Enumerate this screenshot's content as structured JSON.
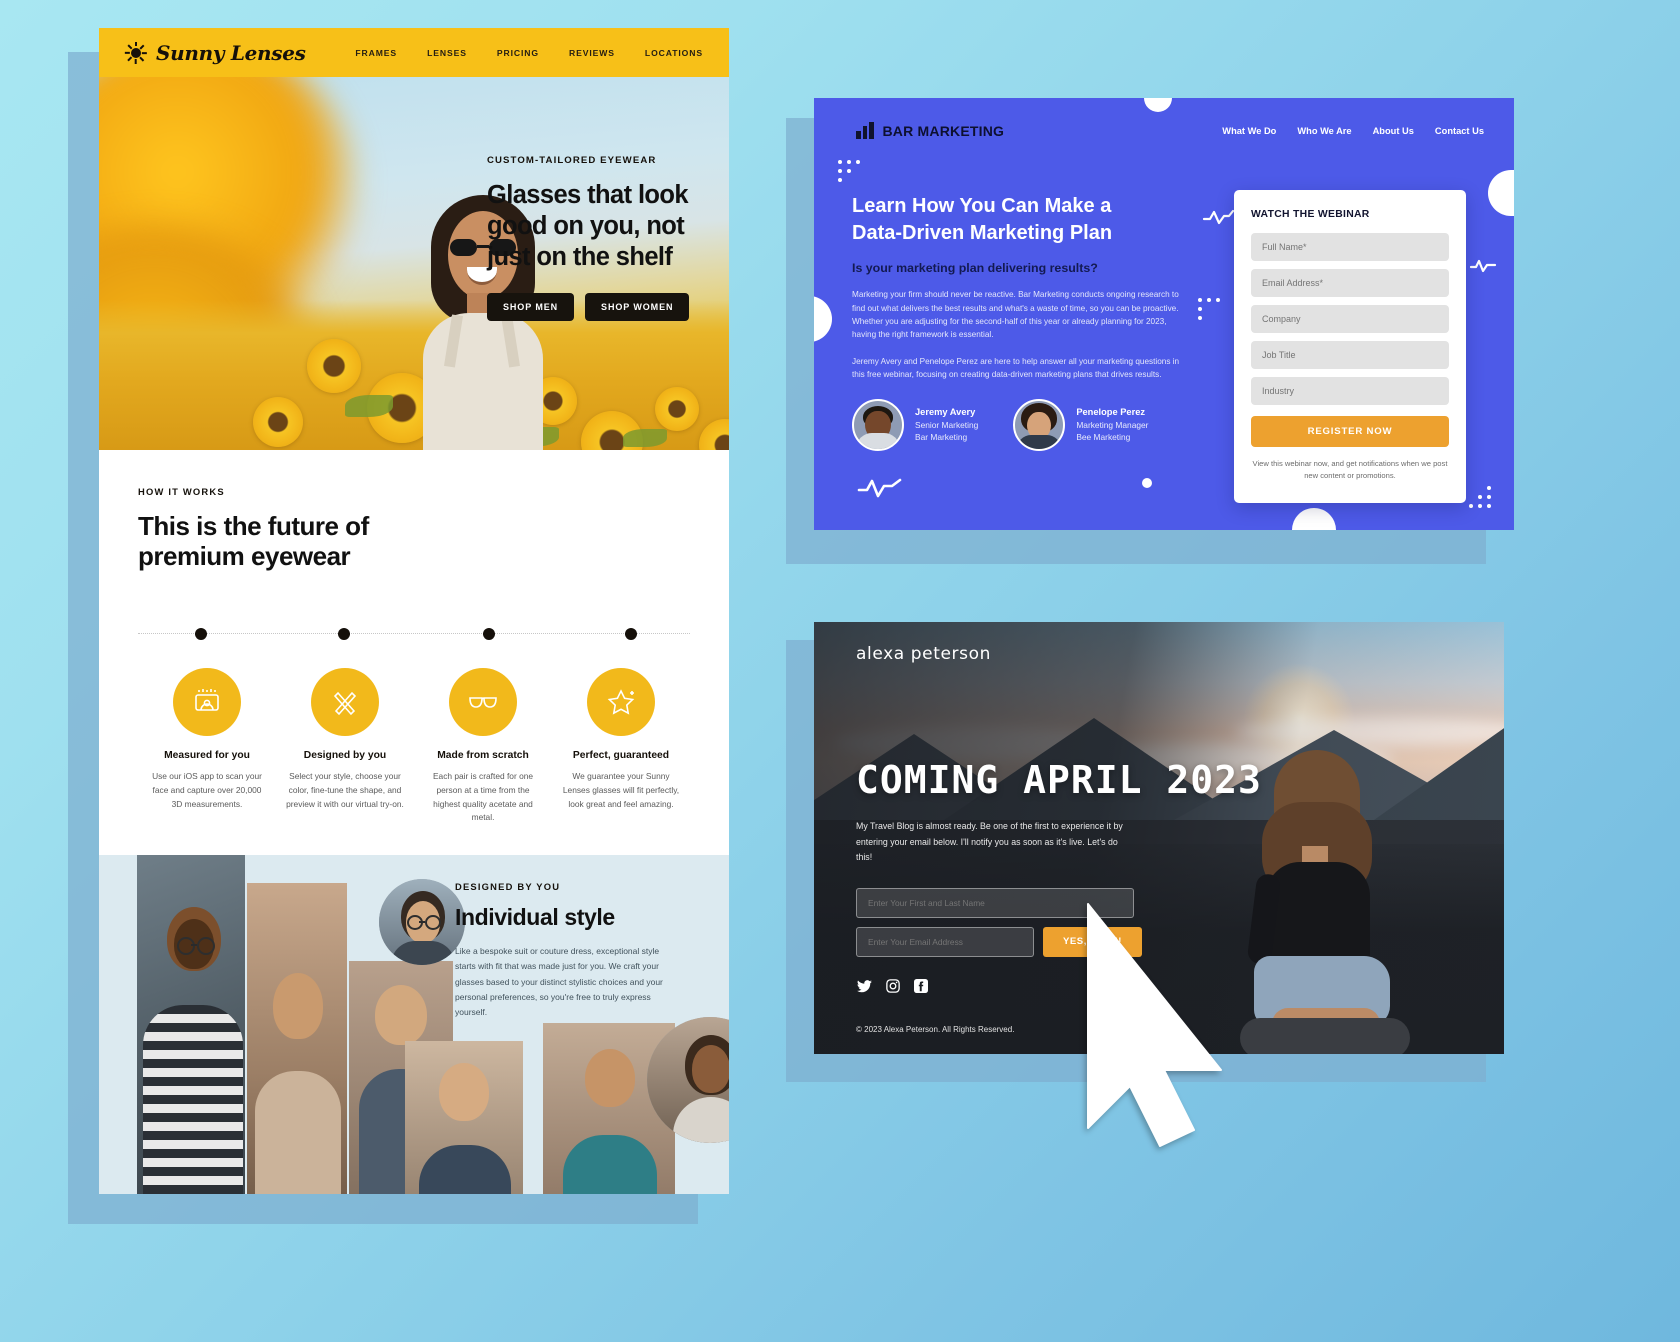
{
  "canvas": {
    "accent_yellow": "#f2b91b",
    "accent_blue": "#4d5ae8",
    "accent_orange": "#eda12f"
  },
  "sunny": {
    "brand": "Sunny Lenses",
    "logo_icon": "sun-icon",
    "nav": [
      "FRAMES",
      "LENSES",
      "PRICING",
      "REVIEWS",
      "LOCATIONS"
    ],
    "hero": {
      "eyebrow": "CUSTOM-TAILORED EYEWEAR",
      "heading_lines": [
        "Glasses that look",
        "good on you, not",
        "just on the shelf"
      ],
      "buttons": [
        "SHOP MEN",
        "SHOP WOMEN"
      ]
    },
    "how": {
      "label": "HOW IT WORKS",
      "heading_lines": [
        "This is the future of",
        "premium eyewear"
      ],
      "cards": [
        {
          "icon": "face-scan-icon",
          "title": "Measured for you",
          "text": "Use our iOS app to scan your face and capture over 20,000 3D measurements."
        },
        {
          "icon": "pencil-ruler-icon",
          "title": "Designed by you",
          "text": "Select your style, choose your color, fine-tune the shape, and preview it with our virtual try-on."
        },
        {
          "icon": "glasses-icon",
          "title": "Made from scratch",
          "text": "Each pair is crafted for one person at a time from the highest quality acetate and metal."
        },
        {
          "icon": "star-badge-icon",
          "title": "Perfect, guaranteed",
          "text": "We guarantee your Sunny Lenses glasses will fit perfectly, look great and feel amazing."
        }
      ]
    },
    "individual": {
      "label": "DESIGNED BY YOU",
      "heading": "Individual style",
      "text": "Like a bespoke suit or couture dress, exceptional style starts with fit that was made just for you. We craft your glasses based to your distinct stylistic choices and your personal preferences, so you're free to truly express yourself."
    }
  },
  "bar": {
    "brand": "BAR MARKETING",
    "logo_icon": "bar-chart-icon",
    "nav": [
      "What We Do",
      "Who We Are",
      "About Us",
      "Contact Us"
    ],
    "heading_lines": [
      "Learn How You Can Make a",
      "Data-Driven Marketing Plan"
    ],
    "subheading": "Is your marketing plan delivering results?",
    "paragraph1": "Marketing your firm should never be reactive. Bar Marketing conducts ongoing research to find out what delivers the best results and what's a waste of time, so you can be proactive. Whether you are adjusting for the second-half of this year or already planning for 2023, having the right framework is essential.",
    "paragraph2": "Jeremy Avery and Penelope Perez are here to help answer all your marketing questions in this free webinar, focusing on creating data-driven marketing plans that drives results.",
    "people": [
      {
        "name": "Jeremy Avery",
        "role_line1": "Senior Marketing",
        "role_line2": "Bar Marketing"
      },
      {
        "name": "Penelope Perez",
        "role_line1": "Marketing Manager",
        "role_line2": "Bee Marketing"
      }
    ],
    "form": {
      "title": "WATCH THE WEBINAR",
      "fields": [
        "Full Name*",
        "Email Address*",
        "Company",
        "Job Title",
        "Industry"
      ],
      "submit": "REGISTER NOW",
      "note": "View this webinar now, and get notifications when we post new content or promotions."
    }
  },
  "alexa": {
    "logo": "alexa peterson",
    "heading": "COMING APRIL 2023",
    "paragraph": "My Travel Blog is almost ready. Be one of the first to experience it by entering your email below. I'll notify you as soon as it's live. Let's do this!",
    "form": {
      "name_placeholder": "Enter Your First and Last Name",
      "email_placeholder": "Enter Your Email Address",
      "submit": "YES, I'M IN!"
    },
    "social": [
      "twitter-icon",
      "instagram-icon",
      "facebook-icon"
    ],
    "copyright": "© 2023 Alexa Peterson. All Rights Reserved."
  },
  "cursor": {
    "icon": "mouse-pointer-icon"
  }
}
